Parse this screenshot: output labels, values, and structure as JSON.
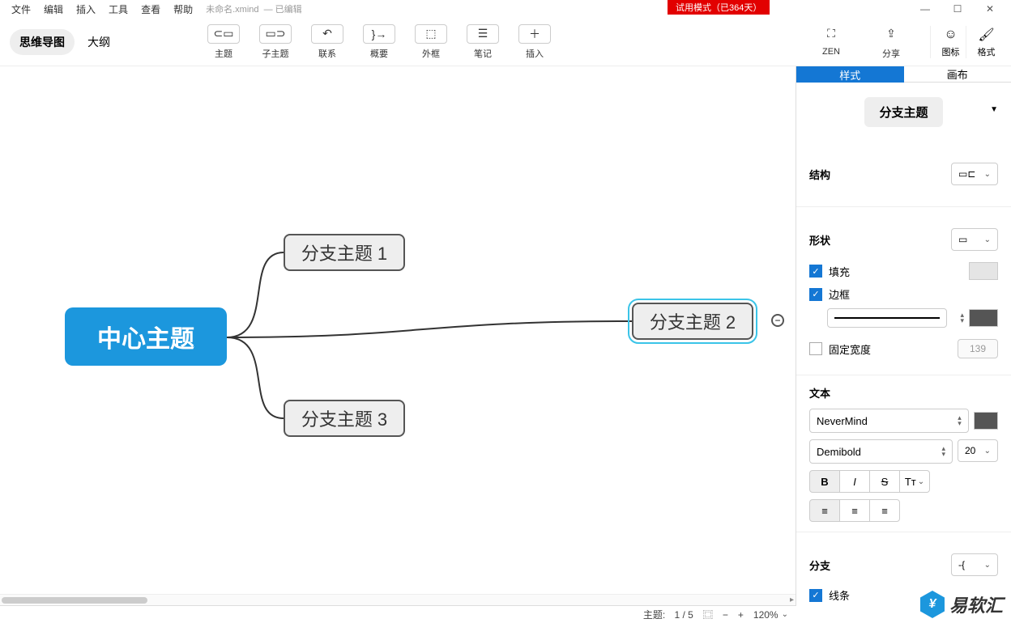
{
  "menu": [
    "文件",
    "编辑",
    "插入",
    "工具",
    "查看",
    "帮助"
  ],
  "filename": "未命名.xmind",
  "filestatus": "— 已编辑",
  "trial": "试用模式（已364天）",
  "viewtabs": {
    "mindmap": "思维导图",
    "outline": "大纲"
  },
  "tools": {
    "topic": "主题",
    "subtopic": "子主题",
    "relation": "联系",
    "summary": "概要",
    "boundary": "外框",
    "note": "笔记",
    "insert": "插入",
    "zen": "ZEN",
    "share": "分享",
    "icon": "图标",
    "format": "格式"
  },
  "nodes": {
    "central": "中心主题",
    "b1": "分支主题 1",
    "b2": "分支主题 2",
    "b3": "分支主题 3"
  },
  "panel": {
    "tab_style": "样式",
    "tab_canvas": "画布",
    "topic_type": "分支主题",
    "sec_structure": "结构",
    "sec_shape": "形状",
    "fill": "填充",
    "border": "边框",
    "fixedwidth": "固定宽度",
    "fixedwidth_val": "139",
    "sec_text": "文本",
    "font_family": "NeverMind",
    "font_weight": "Demibold",
    "font_size": "20",
    "sec_branch": "分支",
    "line": "线条"
  },
  "status": {
    "topic_label": "主题:",
    "topic_count": "1 / 5",
    "zoom": "120%"
  },
  "watermark": "易软汇"
}
